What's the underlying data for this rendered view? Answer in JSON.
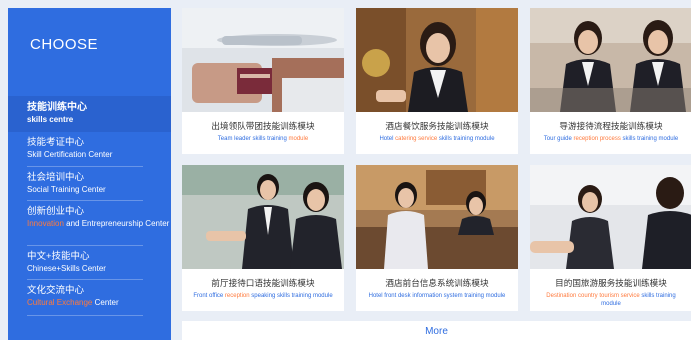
{
  "sidebar": {
    "heading": "CHOOSE",
    "items": [
      {
        "cn": "技能训练中心",
        "en": "skills centre",
        "en_pre": "",
        "en_hl": "",
        "en_post": ""
      },
      {
        "cn": "技能考证中心",
        "en": "Skill Certification Center",
        "en_pre": "",
        "en_hl": "",
        "en_post": ""
      },
      {
        "cn": "社会培训中心",
        "en": "Social Training Center",
        "en_pre": "",
        "en_hl": "",
        "en_post": ""
      },
      {
        "cn": "创新创业中心",
        "en": "",
        "en_pre": "",
        "en_hl": "Innovation",
        "en_post": " and Entrepreneurship Center"
      },
      {
        "cn": "中文+技能中心",
        "en": "Chinese+Skills Center",
        "en_pre": "",
        "en_hl": "",
        "en_post": ""
      },
      {
        "cn": "文化交流中心",
        "en": "",
        "en_pre": "",
        "en_hl": "Cultural Exchange",
        "en_post": " Center"
      }
    ]
  },
  "cards": [
    {
      "cn": "出境领队带团技能训练模块",
      "en_pre": "Team leader skills training ",
      "en_hl": "module",
      "en_post": ""
    },
    {
      "cn": "酒店餐饮服务技能训练模块",
      "en_pre": "Hotel ",
      "en_hl": "catering service",
      "en_post": " skills training module"
    },
    {
      "cn": "导游接待流程技能训练模块",
      "en_pre": "Tour guide ",
      "en_hl": "reception process",
      "en_post": " skills training module"
    },
    {
      "cn": "前厅接待口语技能训练模块",
      "en_pre": "Front office ",
      "en_hl": "reception",
      "en_post": " speaking skills training module"
    },
    {
      "cn": "酒店前台信息系统训练模块",
      "en_pre": "Hotel front desk information system training module",
      "en_hl": "",
      "en_post": ""
    },
    {
      "cn": "目的国旅游服务技能训练模块",
      "en_pre": "",
      "en_hl": "Destination country tourism service",
      "en_post": " skills training module"
    }
  ],
  "more_label": "More"
}
